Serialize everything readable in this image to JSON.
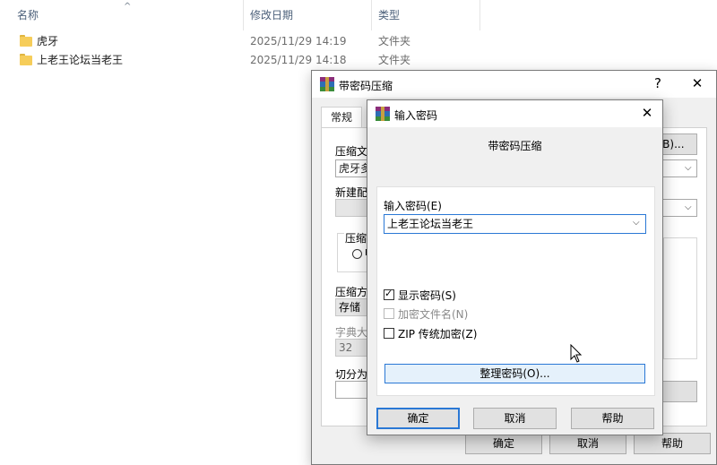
{
  "explorer": {
    "columns": {
      "name": "名称",
      "modified": "修改日期",
      "type": "类型"
    },
    "files": [
      {
        "name": "虎牙",
        "modified": "2025/11/29 14:19",
        "type": "文件夹"
      },
      {
        "name": "上老王论坛当老王",
        "modified": "2025/11/29 14:18",
        "type": "文件夹"
      }
    ]
  },
  "archive_dialog": {
    "title": "带密码压缩",
    "help_glyph": "?",
    "close_glyph": "✕",
    "tab_general": "常规",
    "archive_name_label": "压缩文",
    "archive_name_value": "虎牙多",
    "browse_button": "(B)...",
    "profile_label": "新建配",
    "format_group_label": "压缩文",
    "format_radio_fragment": "R",
    "method_label": "压缩方",
    "method_value": "存储",
    "dict_label": "字典大",
    "dict_value": "32",
    "split_label": "切分为",
    "ok": "确定",
    "cancel": "取消",
    "help": "帮助"
  },
  "password_dialog": {
    "title": "输入密码",
    "close_glyph": "✕",
    "heading": "带密码压缩",
    "password_label": "输入密码(E)",
    "password_value": "上老王论坛当老王",
    "show_password": {
      "label": "显示密码(S)",
      "checked": true
    },
    "encrypt_filenames": {
      "label": "加密文件名(N)",
      "checked": false,
      "disabled": true
    },
    "zip_legacy": {
      "label": "ZIP 传统加密(Z)",
      "checked": false
    },
    "organize_button": "整理密码(O)...",
    "ok": "确定",
    "cancel": "取消",
    "help": "帮助"
  },
  "icons": {
    "folder": "folder-icon",
    "winrar": "winrar-icon",
    "cursor": "mouse-cursor-icon",
    "dropdown": "chevron-down-icon",
    "sort": "sort-up-icon"
  }
}
